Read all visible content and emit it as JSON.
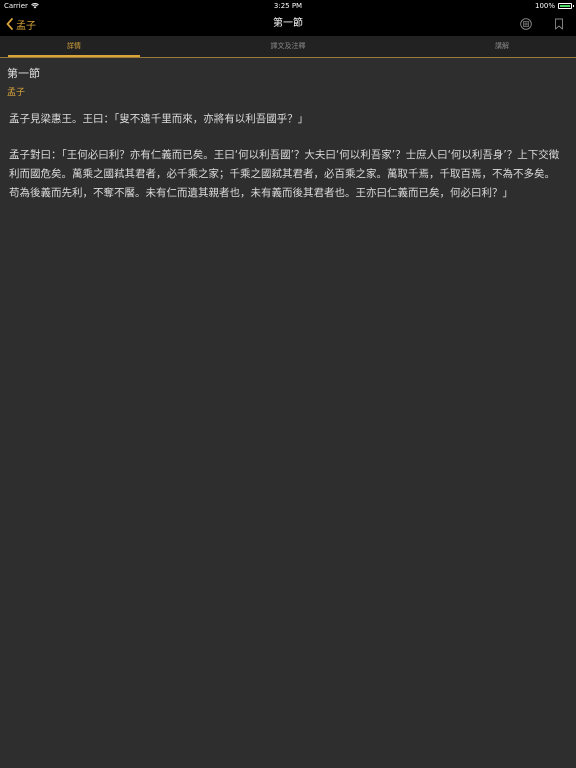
{
  "status_bar": {
    "carrier": "Carrier",
    "time": "3:25 PM",
    "battery": "100%"
  },
  "nav": {
    "back_label": "孟子",
    "title": "第一節",
    "icons": [
      "list-icon",
      "bookmark-icon"
    ]
  },
  "tabs": [
    {
      "label": "詳情",
      "active": true
    },
    {
      "label": "譯文及注釋",
      "active": false
    },
    {
      "label": "講解",
      "active": false
    }
  ],
  "content": {
    "section_title": "第一節",
    "author": "孟子",
    "paragraphs": [
      "孟子見梁惠王。王曰：「叟不遠千里而來，亦將有以利吾國乎？」",
      "孟子對曰：「王何必曰利？亦有仁義而已矣。王曰‘何以利吾國’？大夫曰‘何以利吾家’？士庶人曰‘何以利吾身’？上下交徵利而國危矣。萬乘之國弒其君者，必千乘之家；千乘之國弒其君者，必百乘之家。萬取千焉，千取百焉，不為不多矣。苟為後義而先利，不奪不饜。未有仁而遺其親者也，未有義而後其君者也。王亦曰仁義而已矣，何必曰利？」"
    ]
  },
  "colors": {
    "accent": "#d9a53a",
    "background": "#2e2e2e",
    "bar": "#000000"
  }
}
